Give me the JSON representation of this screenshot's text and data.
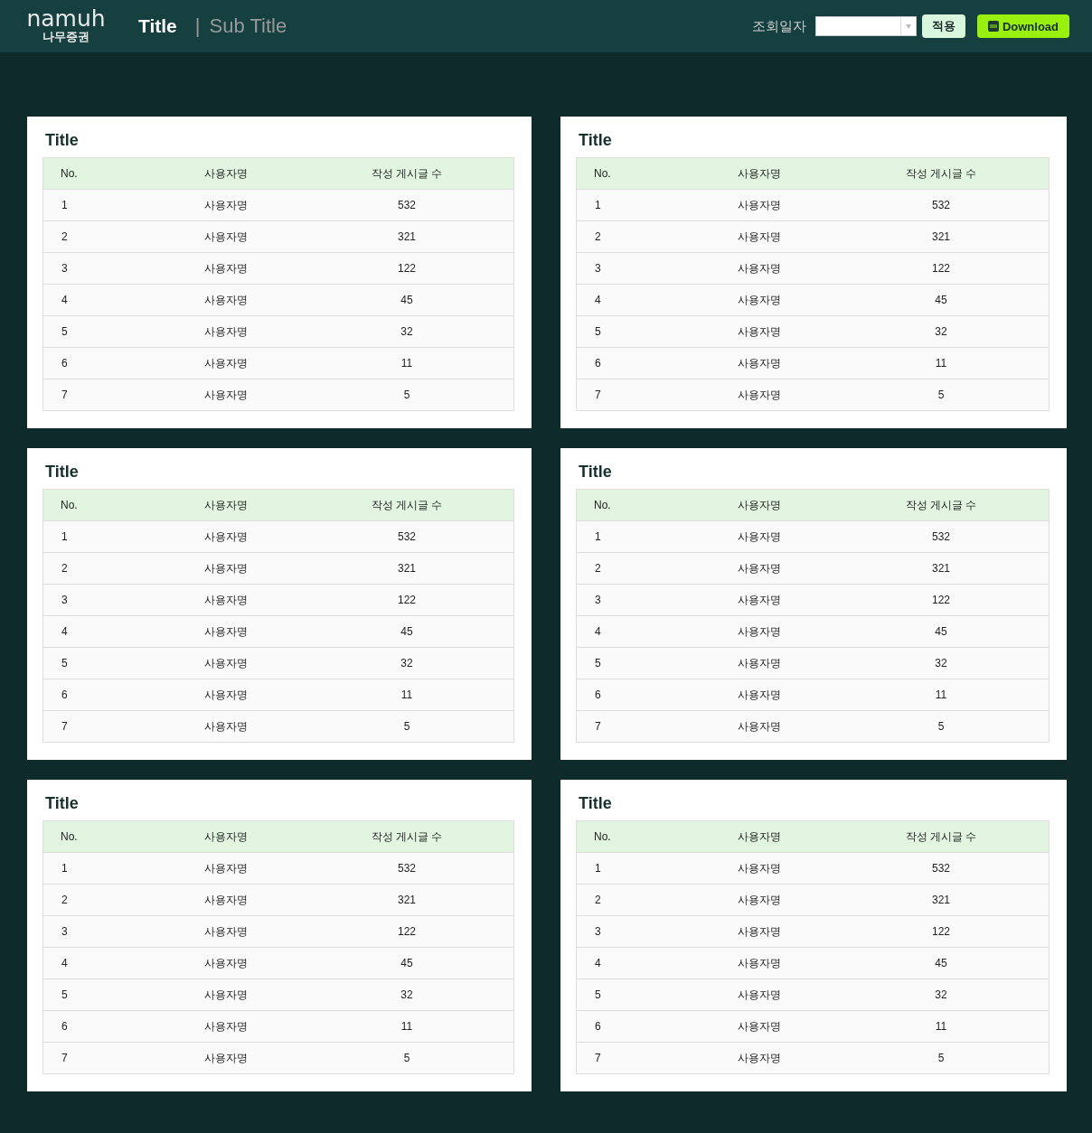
{
  "header": {
    "logo": "namuh",
    "logo_sub": "나무증권",
    "title": "Title",
    "separator": "|",
    "subtitle": "Sub Title",
    "date_label": "조회일자",
    "apply_button": "적용",
    "download_button": "Download"
  },
  "panels": [
    {
      "title": "Title",
      "columns": [
        "No.",
        "사용자명",
        "작성 게시글 수"
      ],
      "rows": [
        [
          "1",
          "사용자명",
          "532"
        ],
        [
          "2",
          "사용자명",
          "321"
        ],
        [
          "3",
          "사용자명",
          "122"
        ],
        [
          "4",
          "사용자명",
          "45"
        ],
        [
          "5",
          "사용자명",
          "32"
        ],
        [
          "6",
          "사용자명",
          "11"
        ],
        [
          "7",
          "사용자명",
          "5"
        ]
      ]
    },
    {
      "title": "Title",
      "columns": [
        "No.",
        "사용자명",
        "작성 게시글 수"
      ],
      "rows": [
        [
          "1",
          "사용자명",
          "532"
        ],
        [
          "2",
          "사용자명",
          "321"
        ],
        [
          "3",
          "사용자명",
          "122"
        ],
        [
          "4",
          "사용자명",
          "45"
        ],
        [
          "5",
          "사용자명",
          "32"
        ],
        [
          "6",
          "사용자명",
          "11"
        ],
        [
          "7",
          "사용자명",
          "5"
        ]
      ]
    },
    {
      "title": "Title",
      "columns": [
        "No.",
        "사용자명",
        "작성 게시글 수"
      ],
      "rows": [
        [
          "1",
          "사용자명",
          "532"
        ],
        [
          "2",
          "사용자명",
          "321"
        ],
        [
          "3",
          "사용자명",
          "122"
        ],
        [
          "4",
          "사용자명",
          "45"
        ],
        [
          "5",
          "사용자명",
          "32"
        ],
        [
          "6",
          "사용자명",
          "11"
        ],
        [
          "7",
          "사용자명",
          "5"
        ]
      ]
    },
    {
      "title": "Title",
      "columns": [
        "No.",
        "사용자명",
        "작성 게시글 수"
      ],
      "rows": [
        [
          "1",
          "사용자명",
          "532"
        ],
        [
          "2",
          "사용자명",
          "321"
        ],
        [
          "3",
          "사용자명",
          "122"
        ],
        [
          "4",
          "사용자명",
          "45"
        ],
        [
          "5",
          "사용자명",
          "32"
        ],
        [
          "6",
          "사용자명",
          "11"
        ],
        [
          "7",
          "사용자명",
          "5"
        ]
      ]
    },
    {
      "title": "Title",
      "columns": [
        "No.",
        "사용자명",
        "작성 게시글 수"
      ],
      "rows": [
        [
          "1",
          "사용자명",
          "532"
        ],
        [
          "2",
          "사용자명",
          "321"
        ],
        [
          "3",
          "사용자명",
          "122"
        ],
        [
          "4",
          "사용자명",
          "45"
        ],
        [
          "5",
          "사용자명",
          "32"
        ],
        [
          "6",
          "사용자명",
          "11"
        ],
        [
          "7",
          "사용자명",
          "5"
        ]
      ]
    },
    {
      "title": "Title",
      "columns": [
        "No.",
        "사용자명",
        "작성 게시글 수"
      ],
      "rows": [
        [
          "1",
          "사용자명",
          "532"
        ],
        [
          "2",
          "사용자명",
          "321"
        ],
        [
          "3",
          "사용자명",
          "122"
        ],
        [
          "4",
          "사용자명",
          "45"
        ],
        [
          "5",
          "사용자명",
          "32"
        ],
        [
          "6",
          "사용자명",
          "11"
        ],
        [
          "7",
          "사용자명",
          "5"
        ]
      ]
    }
  ]
}
